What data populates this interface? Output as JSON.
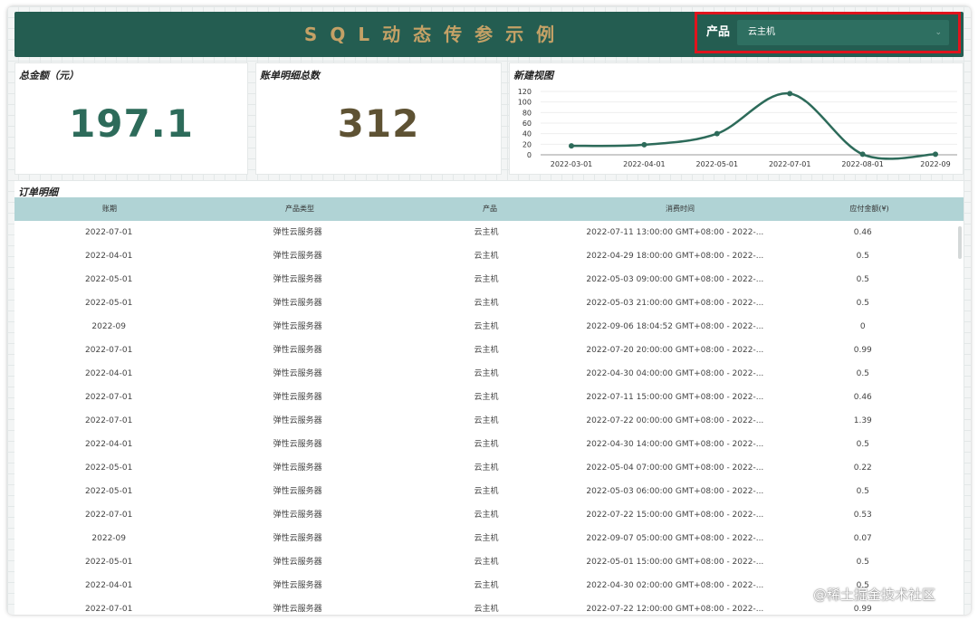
{
  "header": {
    "title": "SQL动态传参示例",
    "filter_label": "产品",
    "filter_value": "云主机"
  },
  "cards": {
    "total_amount": {
      "label": "总金额（元）",
      "value": "197.1",
      "color": "#2d6b5a"
    },
    "detail_count": {
      "label": "账单明细总数",
      "value": "312",
      "color": "#5e5233"
    },
    "chart_label": "新建视图"
  },
  "chart_data": {
    "type": "line",
    "categories": [
      "2022-03-01",
      "2022-04-01",
      "2022-05-01",
      "2022-07-01",
      "2022-08-01",
      "2022-09"
    ],
    "values": [
      17,
      19,
      40,
      116,
      1,
      1
    ],
    "ylim": [
      0,
      120
    ],
    "yticks": [
      0,
      20,
      40,
      60,
      80,
      100,
      120
    ],
    "smooth": true,
    "color": "#2d6b5a",
    "title": "",
    "xlabel": "",
    "ylabel": ""
  },
  "table": {
    "title": "订单明细",
    "columns": [
      "账期",
      "产品类型",
      "产品",
      "消费时间",
      "应付金额(¥)"
    ],
    "rows": [
      [
        "2022-07-01",
        "弹性云服务器",
        "云主机",
        "2022-07-11 13:00:00 GMT+08:00 - 2022-...",
        "0.46"
      ],
      [
        "2022-04-01",
        "弹性云服务器",
        "云主机",
        "2022-04-29 18:00:00 GMT+08:00 - 2022-...",
        "0.5"
      ],
      [
        "2022-05-01",
        "弹性云服务器",
        "云主机",
        "2022-05-03 09:00:00 GMT+08:00 - 2022-...",
        "0.5"
      ],
      [
        "2022-05-01",
        "弹性云服务器",
        "云主机",
        "2022-05-03 21:00:00 GMT+08:00 - 2022-...",
        "0.5"
      ],
      [
        "2022-09",
        "弹性云服务器",
        "云主机",
        "2022-09-06 18:04:52 GMT+08:00 - 2022-...",
        "0"
      ],
      [
        "2022-07-01",
        "弹性云服务器",
        "云主机",
        "2022-07-20 20:00:00 GMT+08:00 - 2022-...",
        "0.99"
      ],
      [
        "2022-04-01",
        "弹性云服务器",
        "云主机",
        "2022-04-30 04:00:00 GMT+08:00 - 2022-...",
        "0.5"
      ],
      [
        "2022-07-01",
        "弹性云服务器",
        "云主机",
        "2022-07-11 15:00:00 GMT+08:00 - 2022-...",
        "0.46"
      ],
      [
        "2022-07-01",
        "弹性云服务器",
        "云主机",
        "2022-07-22 00:00:00 GMT+08:00 - 2022-...",
        "1.39"
      ],
      [
        "2022-04-01",
        "弹性云服务器",
        "云主机",
        "2022-04-30 14:00:00 GMT+08:00 - 2022-...",
        "0.5"
      ],
      [
        "2022-05-01",
        "弹性云服务器",
        "云主机",
        "2022-05-04 07:00:00 GMT+08:00 - 2022-...",
        "0.22"
      ],
      [
        "2022-05-01",
        "弹性云服务器",
        "云主机",
        "2022-05-03 06:00:00 GMT+08:00 - 2022-...",
        "0.5"
      ],
      [
        "2022-07-01",
        "弹性云服务器",
        "云主机",
        "2022-07-22 15:00:00 GMT+08:00 - 2022-...",
        "0.53"
      ],
      [
        "2022-09",
        "弹性云服务器",
        "云主机",
        "2022-09-07 05:00:00 GMT+08:00 - 2022-...",
        "0.07"
      ],
      [
        "2022-05-01",
        "弹性云服务器",
        "云主机",
        "2022-05-01 15:00:00 GMT+08:00 - 2022-...",
        "0.5"
      ],
      [
        "2022-04-01",
        "弹性云服务器",
        "云主机",
        "2022-04-30 02:00:00 GMT+08:00 - 2022-...",
        "0.5"
      ],
      [
        "2022-07-01",
        "弹性云服务器",
        "云主机",
        "2022-07-22 12:00:00 GMT+08:00 - 2022-...",
        "0.99"
      ]
    ]
  },
  "watermark": "@稀土掘金技术社区"
}
